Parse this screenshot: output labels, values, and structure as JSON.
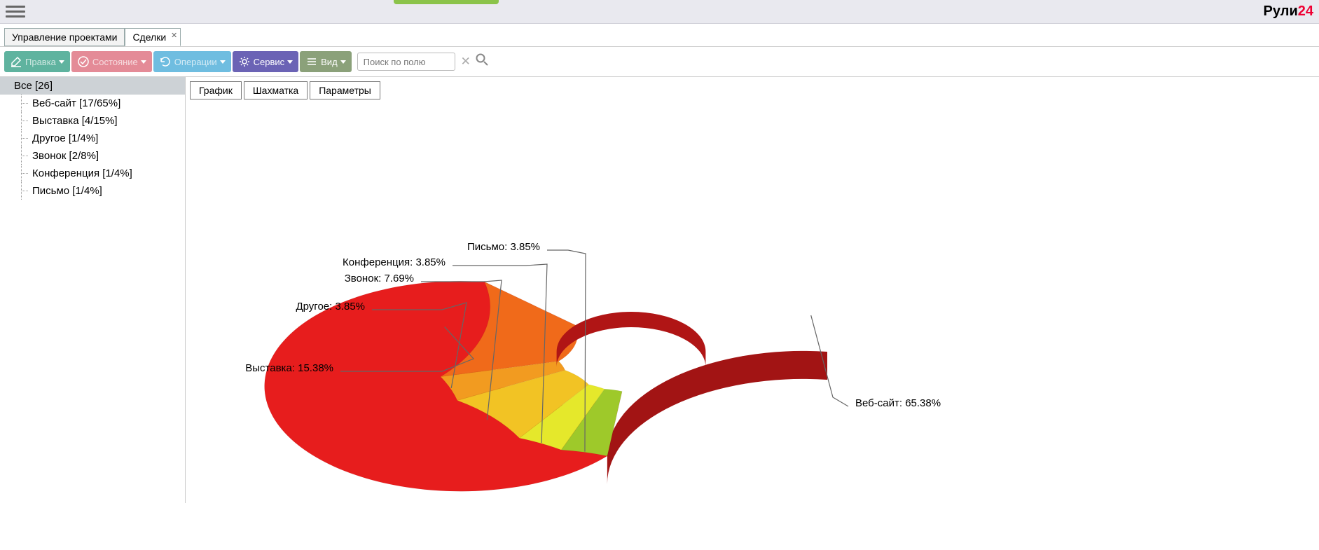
{
  "brand": {
    "name": "Рули",
    "suffix": "24"
  },
  "tabs1": [
    {
      "label": "Управление проектами",
      "active": false
    },
    {
      "label": "Сделки",
      "active": true,
      "closable": true
    }
  ],
  "toolbar": {
    "edit": "Правка",
    "status": "Состояние",
    "ops": "Операции",
    "service": "Сервис",
    "view": "Вид",
    "search_placeholder": "Поиск по полю"
  },
  "sidebar": {
    "root": "Все [26]",
    "items": [
      "Веб-сайт [17/65%]",
      "Выставка [4/15%]",
      "Другое [1/4%]",
      "Звонок [2/8%]",
      "Конференция [1/4%]",
      "Письмо [1/4%]"
    ]
  },
  "subtabs": [
    "График",
    "Шахматка",
    "Параметры"
  ],
  "chart_data": {
    "type": "pie",
    "title": "",
    "series": [
      {
        "name": "Веб-сайт",
        "value": 65.38,
        "label": "Веб-сайт: 65.38%",
        "color": "#e71d1d"
      },
      {
        "name": "Выставка",
        "value": 15.38,
        "label": "Выставка: 15.38%",
        "color": "#f06a1a"
      },
      {
        "name": "Другое",
        "value": 3.85,
        "label": "Другое: 3.85%",
        "color": "#f29b20"
      },
      {
        "name": "Звонок",
        "value": 7.69,
        "label": "Звонок: 7.69%",
        "color": "#f2c324"
      },
      {
        "name": "Конференция",
        "value": 3.85,
        "label": "Конференция: 3.85%",
        "color": "#e5e82b"
      },
      {
        "name": "Письмо",
        "value": 3.85,
        "label": "Письмо: 3.85%",
        "color": "#9ec92a"
      }
    ],
    "inner_radius_frac": 0.38,
    "chart_3d": true
  }
}
